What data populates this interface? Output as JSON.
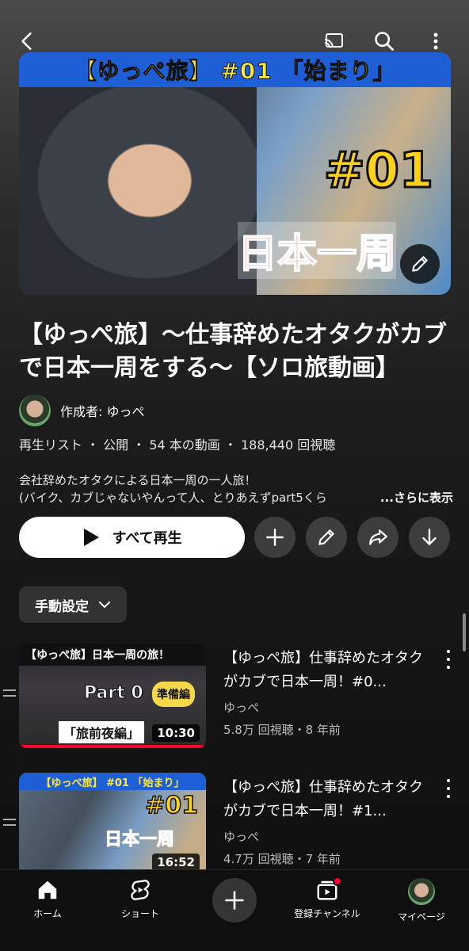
{
  "hero": {
    "band_text": "【ゆっぺ旅】 #01 「始まり」",
    "big_number": "#01",
    "sub_text": "日本一周"
  },
  "playlist": {
    "title": "【ゆっぺ旅】〜仕事辞めたオタクがカブで日本一周をする〜【ソロ旅動画】",
    "creator_label": "作成者: ゆっぺ",
    "meta": "再生リスト ・ 公開 ・ 54 本の動画 ・ 188,440 回視聴",
    "description_line1": "会社辞めたオタクによる日本一周の一人旅！",
    "description_line2": "(バイク、カブじゃないやんって人、とりあえずpart5くら",
    "more_label": "...さらに表示"
  },
  "actions": {
    "play_all": "すべて再生"
  },
  "sort": {
    "label": "手動設定"
  },
  "videos": [
    {
      "thumb_top": "【ゆっぺ旅】日本一周の旅！",
      "thumb_part": "Part 0",
      "thumb_badge": "準備編",
      "thumb_bottom": "「旅前夜編」",
      "duration": "10:30",
      "title": "【ゆっぺ旅】仕事辞めたオタクがカブで日本一周！#0...",
      "channel": "ゆっぺ",
      "meta": "5.8万 回視聴・8 年前"
    },
    {
      "thumb_top": "【ゆっぺ旅】 #01 「始まり」",
      "thumb_part": "#01",
      "thumb_badge": "日本一周",
      "duration": "16:52",
      "title": "【ゆっぺ旅】仕事辞めたオタクがカブで日本一周！#1...",
      "channel": "ゆっぺ",
      "meta": "4.7万 回視聴・7 年前"
    }
  ],
  "nav": {
    "home": "ホーム",
    "shorts": "ショート",
    "subscriptions": "登録チャンネル",
    "mypage": "マイページ"
  },
  "colors": {
    "accent_red": "#ff0033",
    "background": "#0f0f0f"
  }
}
